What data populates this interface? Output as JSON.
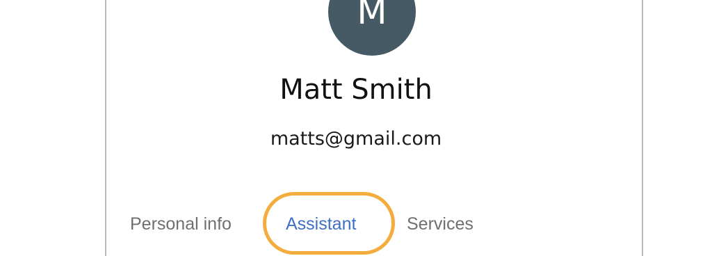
{
  "profile": {
    "avatar_letter": "M",
    "avatar_color": "#455a64",
    "name": "Matt Smith",
    "email": "matts@gmail.com"
  },
  "tabs": [
    {
      "label": "Personal info",
      "selected": false
    },
    {
      "label": "Assistant",
      "selected": true,
      "highlighted": true
    },
    {
      "label": "Services",
      "selected": false
    }
  ],
  "colors": {
    "selected_tab": "#3f6fc4",
    "unselected_tab": "#6f6f6f",
    "highlight": "#f4ad3d"
  }
}
